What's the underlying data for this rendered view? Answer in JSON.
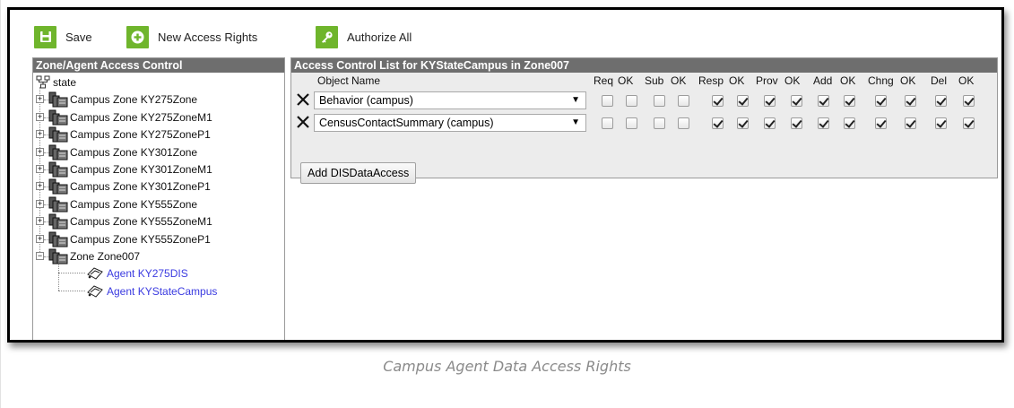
{
  "toolbar": {
    "save_label": "Save",
    "new_label": "New Access Rights",
    "authorize_label": "Authorize All",
    "icons": [
      "save-icon",
      "plus-circle-icon",
      "key-icon"
    ],
    "accent": "#6fb52c"
  },
  "left_panel": {
    "title": "Zone/Agent Access Control",
    "root_label": "state",
    "zones": [
      {
        "label": "Campus Zone KY275Zone",
        "expanded": false
      },
      {
        "label": "Campus Zone KY275ZoneM1",
        "expanded": false
      },
      {
        "label": "Campus Zone KY275ZoneP1",
        "expanded": false
      },
      {
        "label": "Campus Zone KY301Zone",
        "expanded": false
      },
      {
        "label": "Campus Zone KY301ZoneM1",
        "expanded": false
      },
      {
        "label": "Campus Zone KY301ZoneP1",
        "expanded": false
      },
      {
        "label": "Campus Zone KY555Zone",
        "expanded": false
      },
      {
        "label": "Campus Zone KY555ZoneM1",
        "expanded": false
      },
      {
        "label": "Campus Zone KY555ZoneP1",
        "expanded": false
      },
      {
        "label": "Zone Zone007",
        "expanded": true
      }
    ],
    "agents": [
      {
        "label": "Agent KY275DIS"
      },
      {
        "label": "Agent KYStateCampus"
      }
    ]
  },
  "right_panel": {
    "title": "Access Control List for KYStateCampus in Zone007",
    "headers": {
      "object": "Object Name",
      "req": "Req",
      "ok1": "OK",
      "sub": "Sub",
      "ok2": "OK",
      "resp": "Resp",
      "ok3": "OK",
      "prov": "Prov",
      "ok4": "OK",
      "add": "Add",
      "ok5": "OK",
      "chng": "Chng",
      "ok6": "OK",
      "del": "Del",
      "ok7": "OK"
    },
    "rows": [
      {
        "object": "Behavior (campus)",
        "checks": [
          false,
          false,
          false,
          false,
          true,
          true,
          true,
          true,
          true,
          true,
          true,
          true,
          true,
          true
        ]
      },
      {
        "object": "CensusContactSummary (campus)",
        "checks": [
          false,
          false,
          false,
          false,
          true,
          true,
          true,
          true,
          true,
          true,
          true,
          true,
          true,
          true
        ]
      }
    ],
    "add_button": "Add DISDataAccess"
  },
  "caption": "Campus Agent Data Access Rights"
}
